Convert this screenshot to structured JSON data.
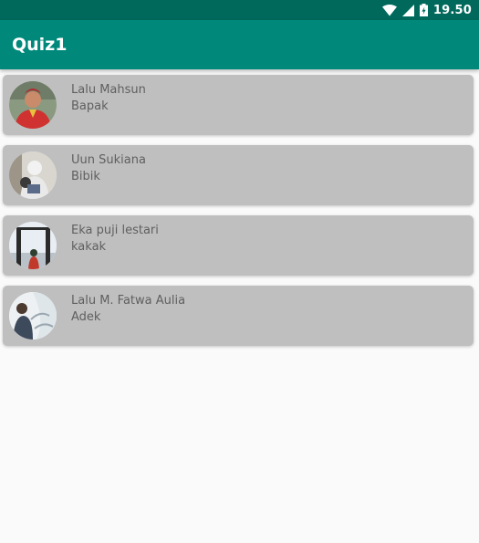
{
  "status_bar": {
    "time": "19.50",
    "icons": [
      "wifi-icon",
      "signal-icon",
      "battery-icon"
    ]
  },
  "app_bar": {
    "title": "Quiz1"
  },
  "contacts": [
    {
      "name": "Lalu Mahsun",
      "relation": "Bapak",
      "avatar": "avatar-photo"
    },
    {
      "name": "Uun Sukiana",
      "relation": "Bibik",
      "avatar": "avatar-photo"
    },
    {
      "name": "Eka puji lestari",
      "relation": "kakak",
      "avatar": "avatar-photo"
    },
    {
      "name": "Lalu M. Fatwa Aulia",
      "relation": "Adek",
      "avatar": "avatar-photo"
    }
  ],
  "colors": {
    "status_bar": "#00695c",
    "app_bar": "#00897b",
    "card": "#bfbfbf",
    "background": "#fafafa",
    "text": "#5f5f5f"
  }
}
